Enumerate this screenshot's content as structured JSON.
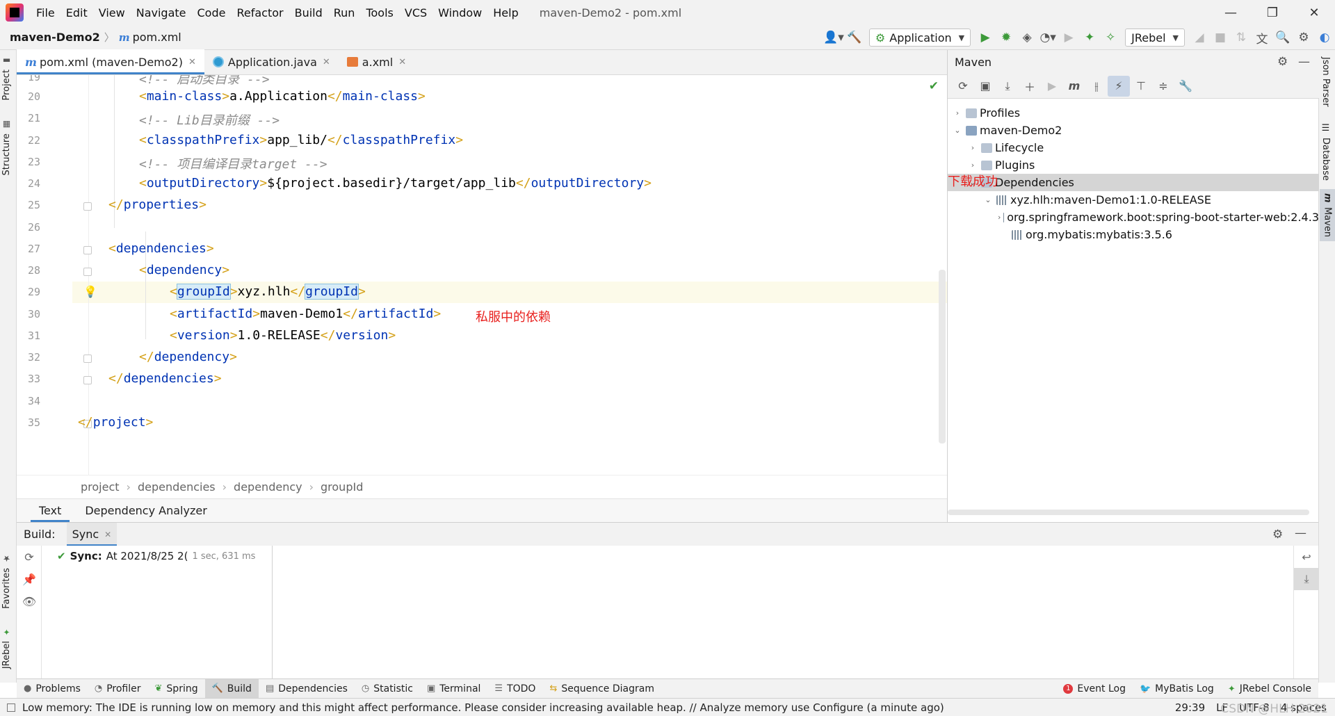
{
  "menu": {
    "items": [
      "File",
      "Edit",
      "View",
      "Navigate",
      "Code",
      "Refactor",
      "Build",
      "Run",
      "Tools",
      "VCS",
      "Window",
      "Help"
    ],
    "window_title": "maven-Demo2 - pom.xml"
  },
  "navbar": {
    "project": "maven-Demo2",
    "file": "pom.xml",
    "run_config": "Application",
    "jrebel_config": "JRebel"
  },
  "left_strip": {
    "project": "Project",
    "structure": "Structure",
    "favorites": "Favorites",
    "jrebel": "JRebel"
  },
  "right_strip": {
    "json_parser": "Json Parser",
    "database": "Database",
    "maven": "Maven"
  },
  "editor_tabs": [
    {
      "label": "pom.xml (maven-Demo2)"
    },
    {
      "label": "Application.java"
    },
    {
      "label": "a.xml"
    }
  ],
  "editor": {
    "lines": [
      {
        "n": "19",
        "code": "<!-- 启动类目录 -->"
      },
      {
        "n": "20",
        "code": "<main-class>a.Application</main-class>"
      },
      {
        "n": "21",
        "code": "<!-- Lib目录前缀 -->"
      },
      {
        "n": "22",
        "code": "<classpathPrefix>app_lib/</classpathPrefix>"
      },
      {
        "n": "23",
        "code": "<!-- 项目编译目录target -->"
      },
      {
        "n": "24",
        "code": "<outputDirectory>${project.basedir}/target/app_lib</outputDirectory>"
      },
      {
        "n": "25",
        "code": "</properties>"
      },
      {
        "n": "26",
        "code": ""
      },
      {
        "n": "27",
        "code": "<dependencies>"
      },
      {
        "n": "28",
        "code": "<dependency>"
      },
      {
        "n": "29",
        "code": "<groupId>xyz.hlh</groupId>"
      },
      {
        "n": "30",
        "code": "<artifactId>maven-Demo1</artifactId>"
      },
      {
        "n": "31",
        "code": "<version>1.0-RELEASE</version>"
      },
      {
        "n": "32",
        "code": "</dependency>"
      },
      {
        "n": "33",
        "code": "</dependencies>"
      },
      {
        "n": "34",
        "code": ""
      },
      {
        "n": "35",
        "code": "</project>"
      }
    ],
    "annotation": "私服中的依赖"
  },
  "xml_breadcrumb": [
    "project",
    "dependencies",
    "dependency",
    "groupId"
  ],
  "editor_bottom_tabs": [
    "Text",
    "Dependency Analyzer"
  ],
  "maven": {
    "title": "Maven",
    "tree": {
      "profiles": "Profiles",
      "project": "maven-Demo2",
      "lifecycle": "Lifecycle",
      "plugins": "Plugins",
      "dependencies": "Dependencies",
      "dep1": "xyz.hlh:maven-Demo1:1.0-RELEASE",
      "dep1_child1": "org.springframework.boot:spring-boot-starter-web:2.4.3",
      "dep1_child2": "org.mybatis:mybatis:3.5.6"
    },
    "annotation": "下载成功"
  },
  "build": {
    "label": "Build:",
    "tab": "Sync",
    "status": "Sync:",
    "timestamp": "At 2021/8/25 2(",
    "duration": "1 sec, 631 ms"
  },
  "tool_windows": {
    "problems": "Problems",
    "profiler": "Profiler",
    "spring": "Spring",
    "build": "Build",
    "dependencies": "Dependencies",
    "statistic": "Statistic",
    "terminal": "Terminal",
    "todo": "TODO",
    "sequence": "Sequence Diagram",
    "event_log": "Event Log",
    "event_count": "1",
    "mybatis_log": "MyBatis Log",
    "jrebel_console": "JRebel Console"
  },
  "status": {
    "message": "Low memory: The IDE is running low on memory and this might affect performance. Please consider increasing available heap. // Analyze memory use   Configure (a minute ago)",
    "position": "29:39",
    "line_sep": "LF",
    "encoding": "UTF-8",
    "indent": "4 spaces",
    "watermark": "CSDN @HLH 2021"
  }
}
